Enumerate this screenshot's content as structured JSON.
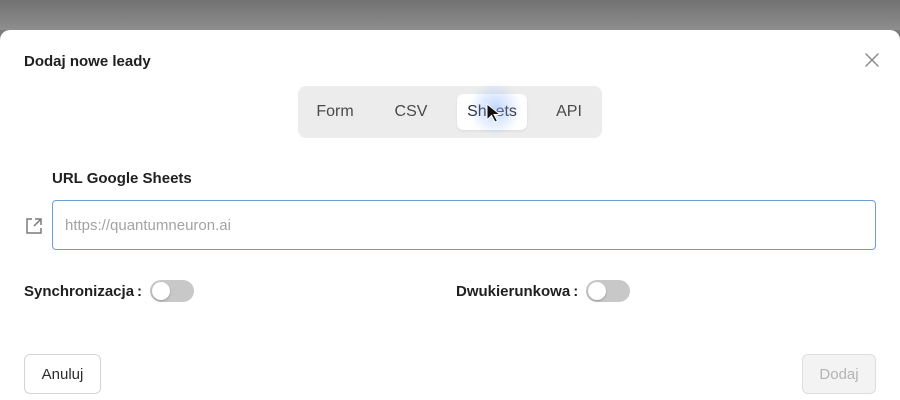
{
  "dialog": {
    "title": "Dodaj nowe leady",
    "close_icon": "close-icon"
  },
  "tabs": [
    {
      "label": "Form",
      "active": false
    },
    {
      "label": "CSV",
      "active": false
    },
    {
      "label": "Sheets",
      "active": true
    },
    {
      "label": "API",
      "active": false
    }
  ],
  "url_field": {
    "label": "URL Google Sheets",
    "placeholder": "https://quantumneuron.ai",
    "value": "",
    "icon": "external-link-icon"
  },
  "toggles": {
    "sync": {
      "label": "Synchronizacja",
      "colon": ":",
      "on": false
    },
    "bidirectional": {
      "label": "Dwukierunkowa",
      "colon": ":",
      "on": false
    }
  },
  "buttons": {
    "cancel": "Anuluj",
    "add": "Dodaj"
  },
  "colors": {
    "input_border": "#6a9fd8",
    "toggle_off": "#c8c8c8",
    "segment_bg": "#ececec",
    "add_disabled_text": "#b4b4b4"
  }
}
